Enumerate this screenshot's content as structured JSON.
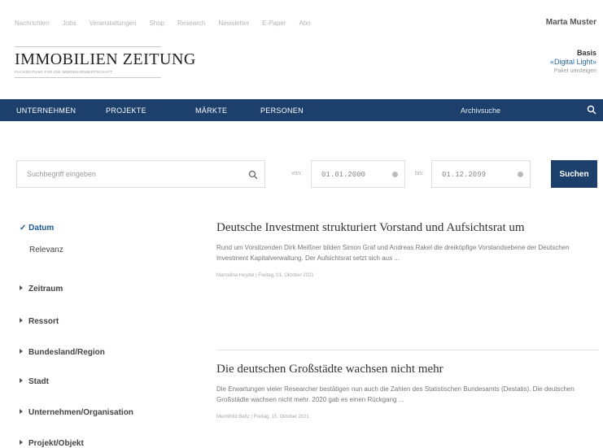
{
  "toplinks": [
    "Nachrichten",
    "Jobs",
    "Veranstaltungen",
    "Shop",
    "Research",
    "Newsletter",
    "E-Paper",
    "Abo"
  ],
  "user": {
    "name": "Marta Muster"
  },
  "logo": {
    "text": "IMMOBILIEN ZEITUNG",
    "subtitle": "FACHZEITUNG FÜR DIE IMMOBILIENWIRTSCHAFT"
  },
  "plan": {
    "name": "Basis",
    "tier": "«Digital Light»",
    "upgrade": "Paket umsteigen"
  },
  "nav": {
    "items": [
      "UNTERNEHMEN",
      "PROJEKTE",
      "MÄRKTE",
      "PERSONEN"
    ],
    "search_label": "Archivsuche"
  },
  "search": {
    "placeholder": "Suchbegriff eingeben",
    "from_label": "von:",
    "from_value": "01.01.2000",
    "to_label": "bis:",
    "to_value": "01.12.2099",
    "submit": "Suchen"
  },
  "sort": {
    "active": "Datum",
    "other": "Relevanz"
  },
  "facets": [
    "Zeitraum",
    "Ressort",
    "Bundesland/Region",
    "Stadt",
    "Unternehmen/Organisation",
    "Projekt/Objekt"
  ],
  "results": [
    {
      "title": "Deutsche Investment strukturiert Vorstand und Aufsichtsrat um",
      "text": "Rund um Vorsitzenden Dirk Meißner bilden Simon Graf und Andreas Rakel die dreiköpfige Vorstandsebene der Deutschen Investment Kapitalverwaltung. Der Aufsichtsrat setzt sich aus ...",
      "meta": "Marcelina Heydel | Freitag, 01. Oktober 2021"
    },
    {
      "title": "Die deutschen Großstädte wachsen nicht mehr",
      "text": "Die Erwartungen vieler Researcher bestätigen nun auch die Zahlen des Statistischen Bundesamts (Destatis). Die deutschen Großstädte wachsen nicht mehr. 2020 gab es einen Rückgang ...",
      "meta": "Mechthild Beltz | Freitag, 15. Oktober 2021"
    }
  ]
}
